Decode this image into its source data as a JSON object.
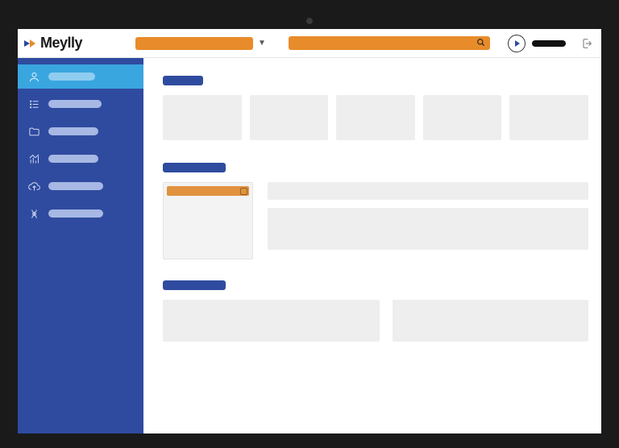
{
  "brand": {
    "name": "Meylly"
  },
  "topbar": {
    "selector_value": "",
    "selector_icon": "chevron-down",
    "search_value": "",
    "search_icon": "search",
    "user_label": "",
    "logout_icon": "logout"
  },
  "sidebar": {
    "items": [
      {
        "icon": "user",
        "label": "",
        "label_width": 58,
        "active": true
      },
      {
        "icon": "list",
        "label": "",
        "label_width": 66,
        "active": false
      },
      {
        "icon": "folder",
        "label": "",
        "label_width": 62,
        "active": false
      },
      {
        "icon": "chart",
        "label": "",
        "label_width": 62,
        "active": false
      },
      {
        "icon": "upload",
        "label": "",
        "label_width": 68,
        "active": false
      },
      {
        "icon": "settings",
        "label": "",
        "label_width": 68,
        "active": false
      }
    ]
  },
  "sections": {
    "s1": {
      "title": "",
      "title_width": 50,
      "cards": [
        1,
        2,
        3,
        4,
        5
      ]
    },
    "s2": {
      "title": "",
      "title_width": 78,
      "panel_tab": ""
    },
    "s3": {
      "title": "",
      "title_width": 78
    }
  },
  "colors": {
    "accent_orange": "#e88b2a",
    "brand_blue": "#2f4b9f",
    "active_cyan": "#3aa6e0",
    "placeholder_grey": "#eeeeee"
  }
}
